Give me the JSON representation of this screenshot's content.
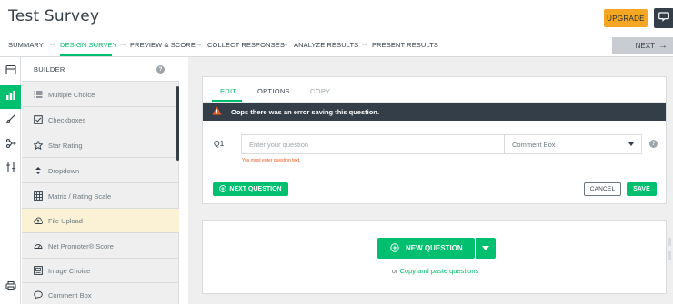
{
  "header": {
    "title": "Test Survey",
    "upgrade_label": "UPGRADE",
    "help_icon": "chat-icon"
  },
  "steps": [
    {
      "label": "SUMMARY"
    },
    {
      "label": "DESIGN SURVEY",
      "active": true
    },
    {
      "label": "PREVIEW & SCORE"
    },
    {
      "label": "COLLECT RESPONSES"
    },
    {
      "label": "ANALYZE RESULTS"
    },
    {
      "label": "PRESENT RESULTS"
    }
  ],
  "next_label": "NEXT",
  "rail": [
    {
      "icon": "survey-icon"
    },
    {
      "icon": "builder-icon",
      "active": true
    },
    {
      "icon": "paint-brush-icon"
    },
    {
      "icon": "logic-icon"
    },
    {
      "icon": "options-icon"
    },
    {
      "icon": "print-icon"
    }
  ],
  "builder": {
    "title": "BUILDER",
    "help": "?",
    "question_types": [
      {
        "label": "Multiple Choice",
        "icon": "list-icon"
      },
      {
        "label": "Checkboxes",
        "icon": "checkbox-icon"
      },
      {
        "label": "Star Rating",
        "icon": "star-icon"
      },
      {
        "label": "Dropdown",
        "icon": "dropdown-icon"
      },
      {
        "label": "Matrix / Rating Scale",
        "icon": "grid-icon"
      },
      {
        "label": "File Upload",
        "icon": "upload-icon",
        "highlight": true
      },
      {
        "label": "Net Promoter® Score",
        "icon": "gauge-icon"
      },
      {
        "label": "Image Choice",
        "icon": "image-icon"
      },
      {
        "label": "Comment Box",
        "icon": "comment-icon"
      }
    ]
  },
  "question_card": {
    "tabs": {
      "edit": "EDIT",
      "options": "OPTIONS",
      "copy": "COPY"
    },
    "error_banner": "Oops there was an error saving this question.",
    "question_number": "Q1",
    "question_placeholder": "Enter your question",
    "question_value": "",
    "type_selected": "Comment Box",
    "help": "?",
    "field_error": "You must enter question text.",
    "next_question_label": "NEXT QUESTION",
    "cancel_label": "CANCEL",
    "save_label": "SAVE"
  },
  "add_card": {
    "new_question_label": "NEW QUESTION",
    "or_text": "or",
    "copy_paste_link": "Copy and paste questions"
  },
  "colors": {
    "accent": "#00bf6f",
    "upgrade": "#f5a623",
    "dark": "#333e48",
    "error": "#f05b24",
    "highlight": "#fbf2d5"
  }
}
